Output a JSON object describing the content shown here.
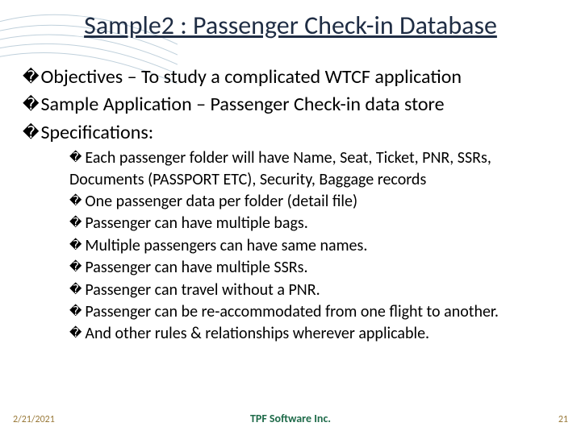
{
  "title": "Sample2 : Passenger Check-in Database",
  "level1": [
    "Objectives – To study a complicated WTCF application",
    "Sample Application – Passenger Check-in data store",
    "Specifications:"
  ],
  "specs": [
    "Each passenger folder will have Name, Seat, Ticket, PNR, SSRs, Documents (PASSPORT ETC), Security, Baggage records",
    "One passenger data per folder (detail file)",
    "Passenger can have multiple bags.",
    "Multiple passengers can have same names.",
    "Passenger can have multiple SSRs.",
    "Passenger can travel without a PNR.",
    "Passenger can be re-accommodated from one flight to another.",
    "And other rules & relationships wherever applicable."
  ],
  "footer": {
    "date": "2/21/2021",
    "center": "TPF Software Inc.",
    "page": "21"
  },
  "bullet": "�"
}
